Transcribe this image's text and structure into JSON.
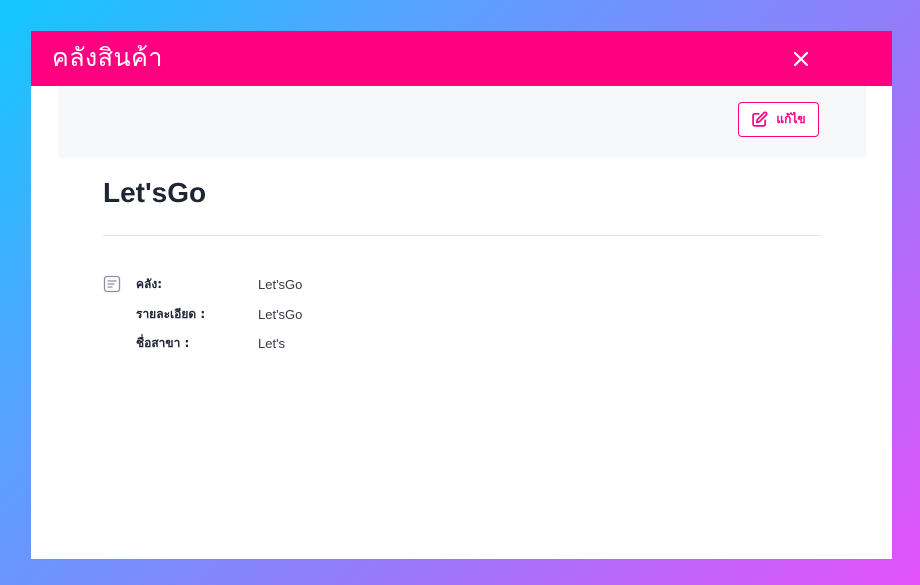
{
  "modal": {
    "title": "คลังสินค้า",
    "edit_label": "แก้ไข",
    "record_title": "Let'sGo",
    "details": [
      {
        "label": "คลัง:",
        "value": "Let'sGo"
      },
      {
        "label": "รายละเอียด :",
        "value": "Let'sGo"
      },
      {
        "label": "ชื่อสาขา :",
        "value": "Let's"
      }
    ]
  },
  "colors": {
    "accent": "#ff0080",
    "panel": "#f7f8fa",
    "text": "#1f2533"
  },
  "icons": {
    "close": "close-icon",
    "edit": "edit-icon",
    "details": "document-icon"
  }
}
